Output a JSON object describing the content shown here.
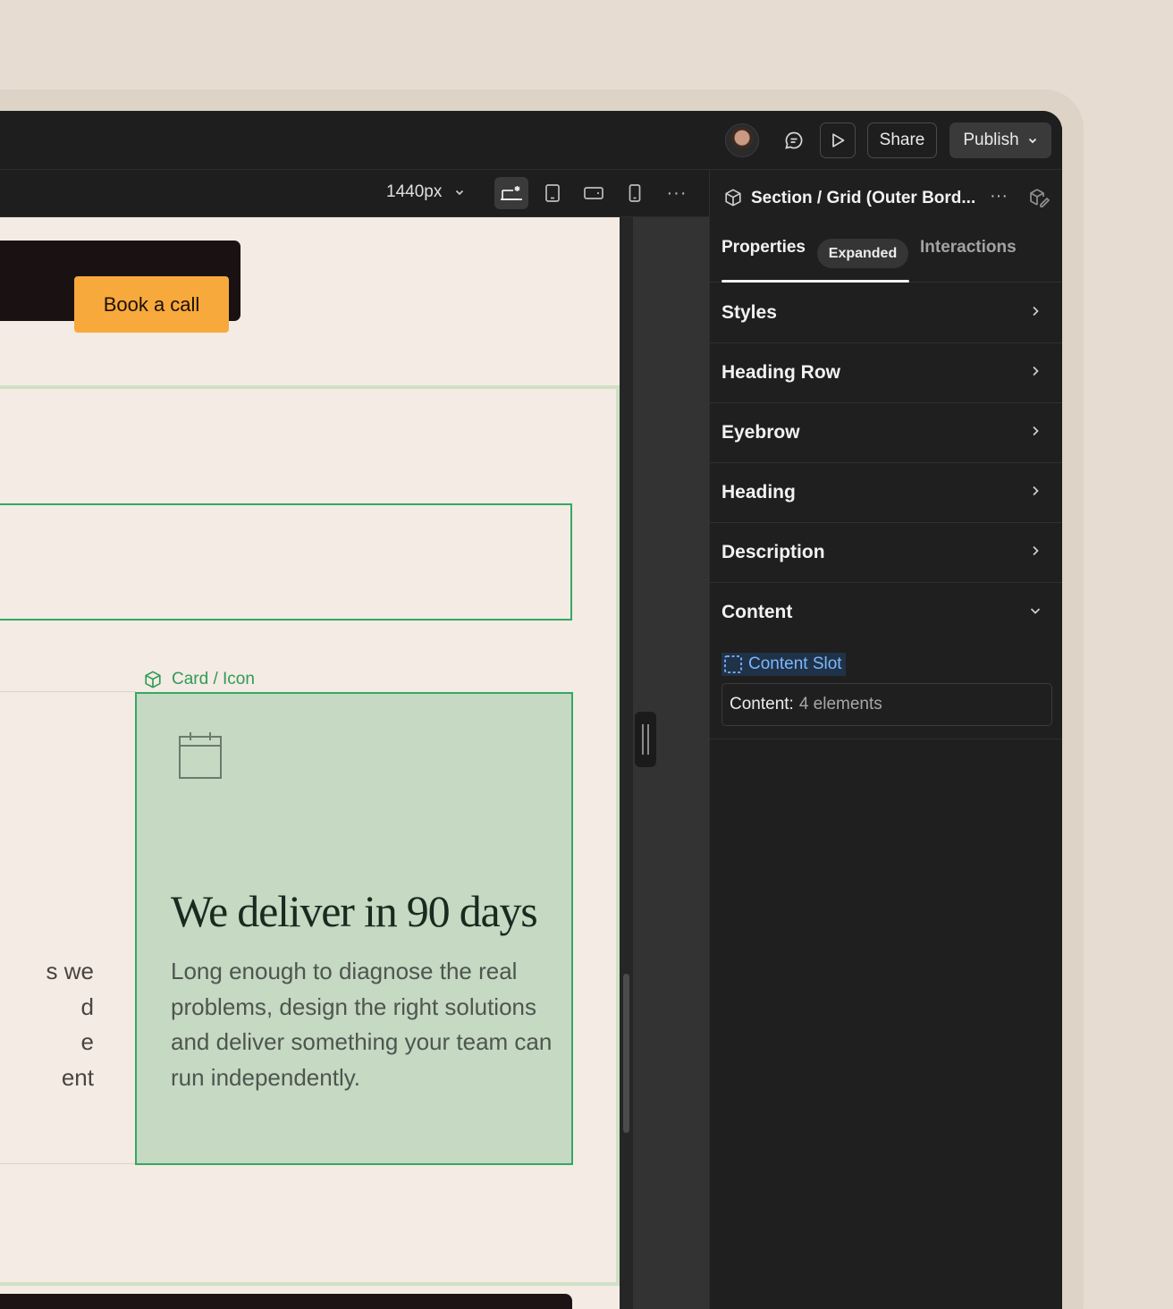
{
  "topbar": {
    "share_label": "Share",
    "publish_label": "Publish",
    "icons": {
      "avatar": "user-avatar",
      "comment": "comment-icon",
      "preview": "play-icon",
      "publish_menu": "chevron-down-icon"
    }
  },
  "view_toolbar": {
    "breakpoint": "1440px",
    "devices": [
      "desktop-breakpoint-icon",
      "tablet-icon",
      "tablet-landscape-icon",
      "mobile-icon"
    ],
    "more": "···"
  },
  "canvas": {
    "book_call_label": "Book a call",
    "card_label": "Card / Icon",
    "card_title": "We deliver in 90 days",
    "card_description": "Long enough to diagnose the real problems, design the right solutions and deliver something your team can run independently.",
    "left_card_fragment": "s we\nd\ne\nent",
    "colors": {
      "accent_green": "#35a862",
      "card_bg": "#c5d9c3",
      "cta": "#f8a93c",
      "canvas_bg": "#f4ebe4"
    }
  },
  "panel": {
    "title": "Section / Grid (Outer Bord...",
    "more": "···",
    "tabs": {
      "properties": "Properties",
      "expanded": "Expanded",
      "interactions": "Interactions"
    },
    "sections": [
      {
        "label": "Styles"
      },
      {
        "label": "Heading Row"
      },
      {
        "label": "Eyebrow"
      },
      {
        "label": "Heading"
      },
      {
        "label": "Description"
      },
      {
        "label": "Content"
      }
    ],
    "content_slot_label": "Content Slot",
    "content_key": "Content:",
    "content_value": "4 elements"
  }
}
